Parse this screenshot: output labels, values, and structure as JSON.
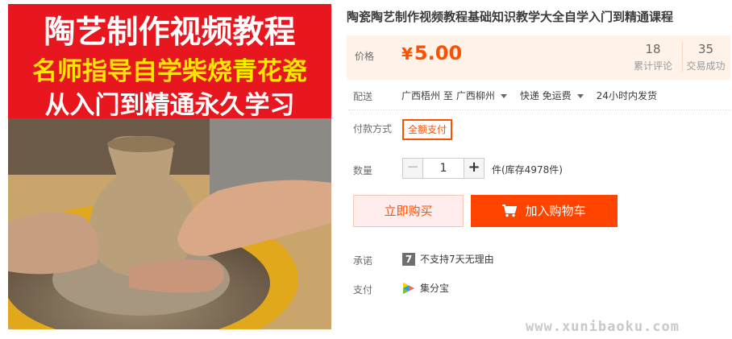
{
  "gallery": {
    "banner_line1": "陶艺制作视频教程",
    "banner_line2": "名师指导自学柴烧青花瓷",
    "banner_line3": "从入门到精通永久学习",
    "banner_bg": "#e8171f",
    "line2_color": "#ffe600"
  },
  "product": {
    "title": "陶瓷陶艺制作视频教程基础知识教学大全自学入门到精通课程"
  },
  "price": {
    "label": "价格",
    "currency": "¥",
    "value": "5.00",
    "reviews_count": "18",
    "reviews_label": "累计评论",
    "sold_count": "35",
    "sold_label": "交易成功"
  },
  "shipping": {
    "label": "配送",
    "from": "广西梧州 至",
    "to": "广西柳州",
    "method": "快递 免运费",
    "dispatch": "24小时内发货"
  },
  "payment_method": {
    "label": "付款方式",
    "option": "全额支付"
  },
  "quantity": {
    "label": "数量",
    "value": "1",
    "minus": "−",
    "plus": "+",
    "stock_text": "件(库存4978件)"
  },
  "actions": {
    "buy_now": "立即购买",
    "add_to_cart": "加入购物车"
  },
  "promise": {
    "label": "承诺",
    "badge": "7",
    "text": "不支持7天无理由"
  },
  "pay": {
    "label": "支付",
    "text": "集分宝"
  },
  "watermark": "www.xunibaoku.com",
  "colors": {
    "accent": "#ff5000",
    "cart_button": "#ff4400",
    "price_bg": "#fff2e8"
  }
}
